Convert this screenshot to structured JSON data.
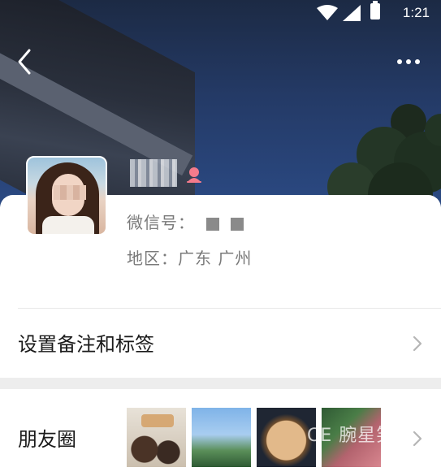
{
  "status_bar": {
    "time": "1:21"
  },
  "profile": {
    "wechat_id_label": "微信号：",
    "region_label": "地区：",
    "region_value": "广东 广州"
  },
  "rows": {
    "remarks_tags": "设置备注和标签",
    "moments": "朋友圈"
  },
  "moments_thumbnails": [
    "food-photo",
    "sky-trees-photo",
    "cat-photo",
    "meat-photo"
  ],
  "watermark": "CE 腕星笑",
  "colors": {
    "cover_sky": "#243a66",
    "gender_female": "#f37b8c",
    "section_gap": "#ededed"
  }
}
